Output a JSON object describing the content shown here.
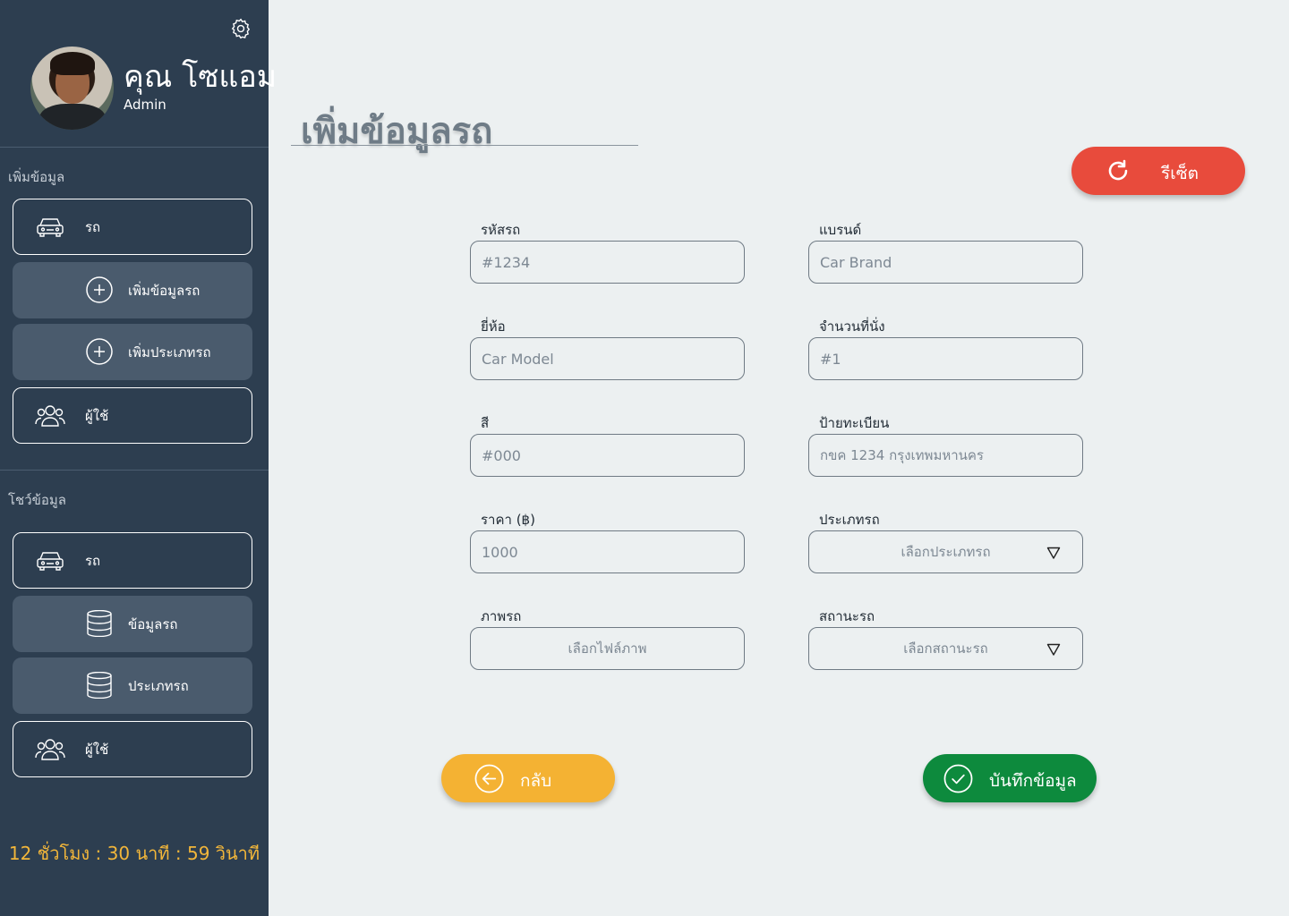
{
  "user": {
    "name": "คุณ โซแอม",
    "role": "Admin"
  },
  "sidebar": {
    "add_section": "เพิ่มข้อมูล",
    "add_items": [
      {
        "label": "รถ",
        "icon": "car-icon"
      },
      {
        "label": "เพิ่มข้อมูลรถ",
        "icon": "plus-circle-icon"
      },
      {
        "label": "เพิ่มประเภทรถ",
        "icon": "plus-circle-icon"
      },
      {
        "label": "ผู้ใช้",
        "icon": "users-icon"
      }
    ],
    "show_section": "โชว์ข้อมูล",
    "show_items": [
      {
        "label": "รถ",
        "icon": "car-icon"
      },
      {
        "label": "ข้อมูลรถ",
        "icon": "database-icon"
      },
      {
        "label": "ประเภทรถ",
        "icon": "database-icon"
      },
      {
        "label": "ผู้ใช้",
        "icon": "users-icon"
      }
    ],
    "timer": "12 ชั่วโมง : 30 นาที : 59 วินาที"
  },
  "main": {
    "title": "เพิ่มข้อมูลรถ",
    "reset_label": "รีเซ็ต",
    "back_label": "กลับ",
    "save_label": "บันทึกข้อมูล"
  },
  "form": {
    "car_id": {
      "label": "รหัสรถ",
      "placeholder": "#1234"
    },
    "brand": {
      "label": "แบรนด์",
      "placeholder": "Car Brand"
    },
    "model": {
      "label": "ยี่ห้อ",
      "placeholder": "Car Model"
    },
    "seats": {
      "label": "จำนวนที่นั่ง",
      "placeholder": "#1"
    },
    "color": {
      "label": "สี",
      "placeholder": "#000"
    },
    "plate": {
      "label": "ป้ายทะเบียน",
      "placeholder": "กขค 1234 กรุงเทพมหานคร"
    },
    "price": {
      "label": "ราคา (฿)",
      "placeholder": "1000"
    },
    "car_type": {
      "label": "ประเภทรถ",
      "value": "เลือกประเภทรถ"
    },
    "image": {
      "label": "ภาพรถ",
      "value": "เลือกไฟล์ภาพ"
    },
    "status": {
      "label": "สถานะรถ",
      "value": "เลือกสถานะรถ"
    }
  },
  "colors": {
    "sidebar": "#2d3e50",
    "reset": "#e84b3c",
    "back": "#f4b233",
    "save": "#0d8a3d",
    "timer": "#f2b63a"
  }
}
